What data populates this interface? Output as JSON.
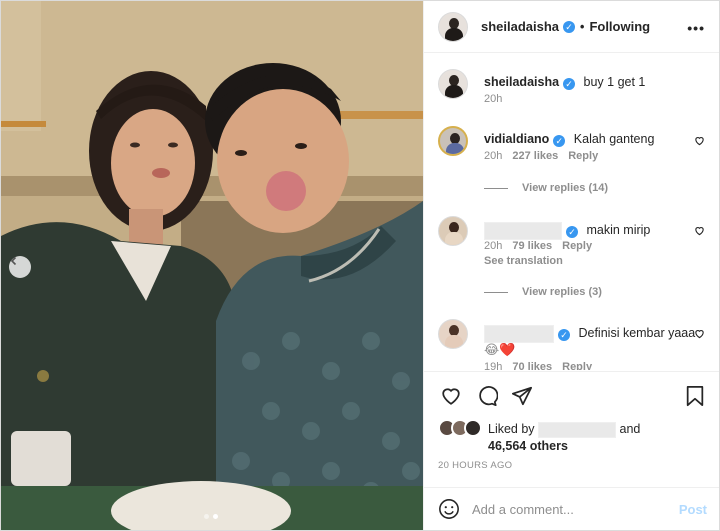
{
  "post": {
    "author": "sheiladaisha",
    "follow_sep": "•",
    "follow_status": "Following",
    "more": "•••",
    "caption": "buy 1 get 1",
    "caption_time": "20h"
  },
  "comments": [
    {
      "user": "vidialdiano",
      "text": "Kalah ganteng",
      "time": "20h",
      "likes": "227 likes",
      "reply": "Reply",
      "replies": "View replies (14)"
    },
    {
      "user": "",
      "text": "makin mirip",
      "time": "20h",
      "likes": "79 likes",
      "reply": "Reply",
      "translation": "See translation",
      "replies": "View replies (3)"
    },
    {
      "user": "",
      "text": "Definisi kembar yaaa",
      "emoji": "😂❤️",
      "time": "19h",
      "likes": "70 likes",
      "reply": "Reply"
    }
  ],
  "likes": {
    "prefix": "Liked by",
    "and": "and",
    "others": "46,564 others"
  },
  "timestamp": "20 HOURS AGO",
  "add_comment": {
    "placeholder": "Add a comment...",
    "post_label": "Post"
  },
  "icons": {
    "heart": "heart-icon",
    "comment": "comment-icon",
    "share": "share-icon",
    "bookmark": "bookmark-icon",
    "emoji": "emoji-icon",
    "verified": "verified-badge-icon"
  },
  "colors": {
    "verified": "#3897f0",
    "post_button": "#b3dbff",
    "heart_red": "#ed4956"
  },
  "carousel": {
    "slide": 2,
    "total": 2
  }
}
